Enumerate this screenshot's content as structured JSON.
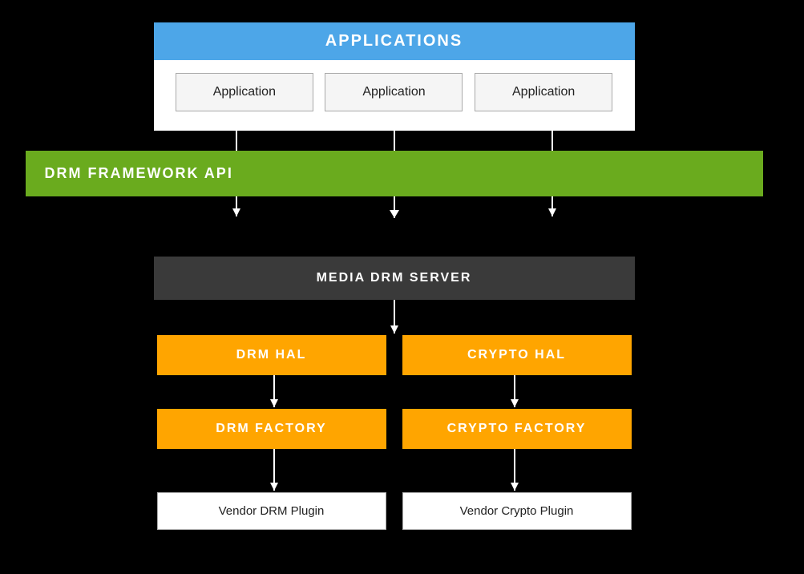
{
  "applications": {
    "header": "APPLICATIONS",
    "apps": [
      "Application",
      "Application",
      "Application"
    ]
  },
  "drm_framework": {
    "label": "DRM FRAMEWORK API"
  },
  "media_drm": {
    "label": "MEDIA DRM SERVER"
  },
  "hal_row": {
    "left": "DRM HAL",
    "right": "CRYPTO HAL"
  },
  "factory_row": {
    "left": "DRM FACTORY",
    "right": "CRYPTO FACTORY"
  },
  "vendor_row": {
    "left": "Vendor DRM Plugin",
    "right": "Vendor Crypto Plugin"
  },
  "colors": {
    "blue": "#4DA6E8",
    "green": "#6AAB1E",
    "orange": "#FFA500",
    "dark_gray": "#3a3a3a",
    "white": "#ffffff",
    "black": "#000000"
  }
}
